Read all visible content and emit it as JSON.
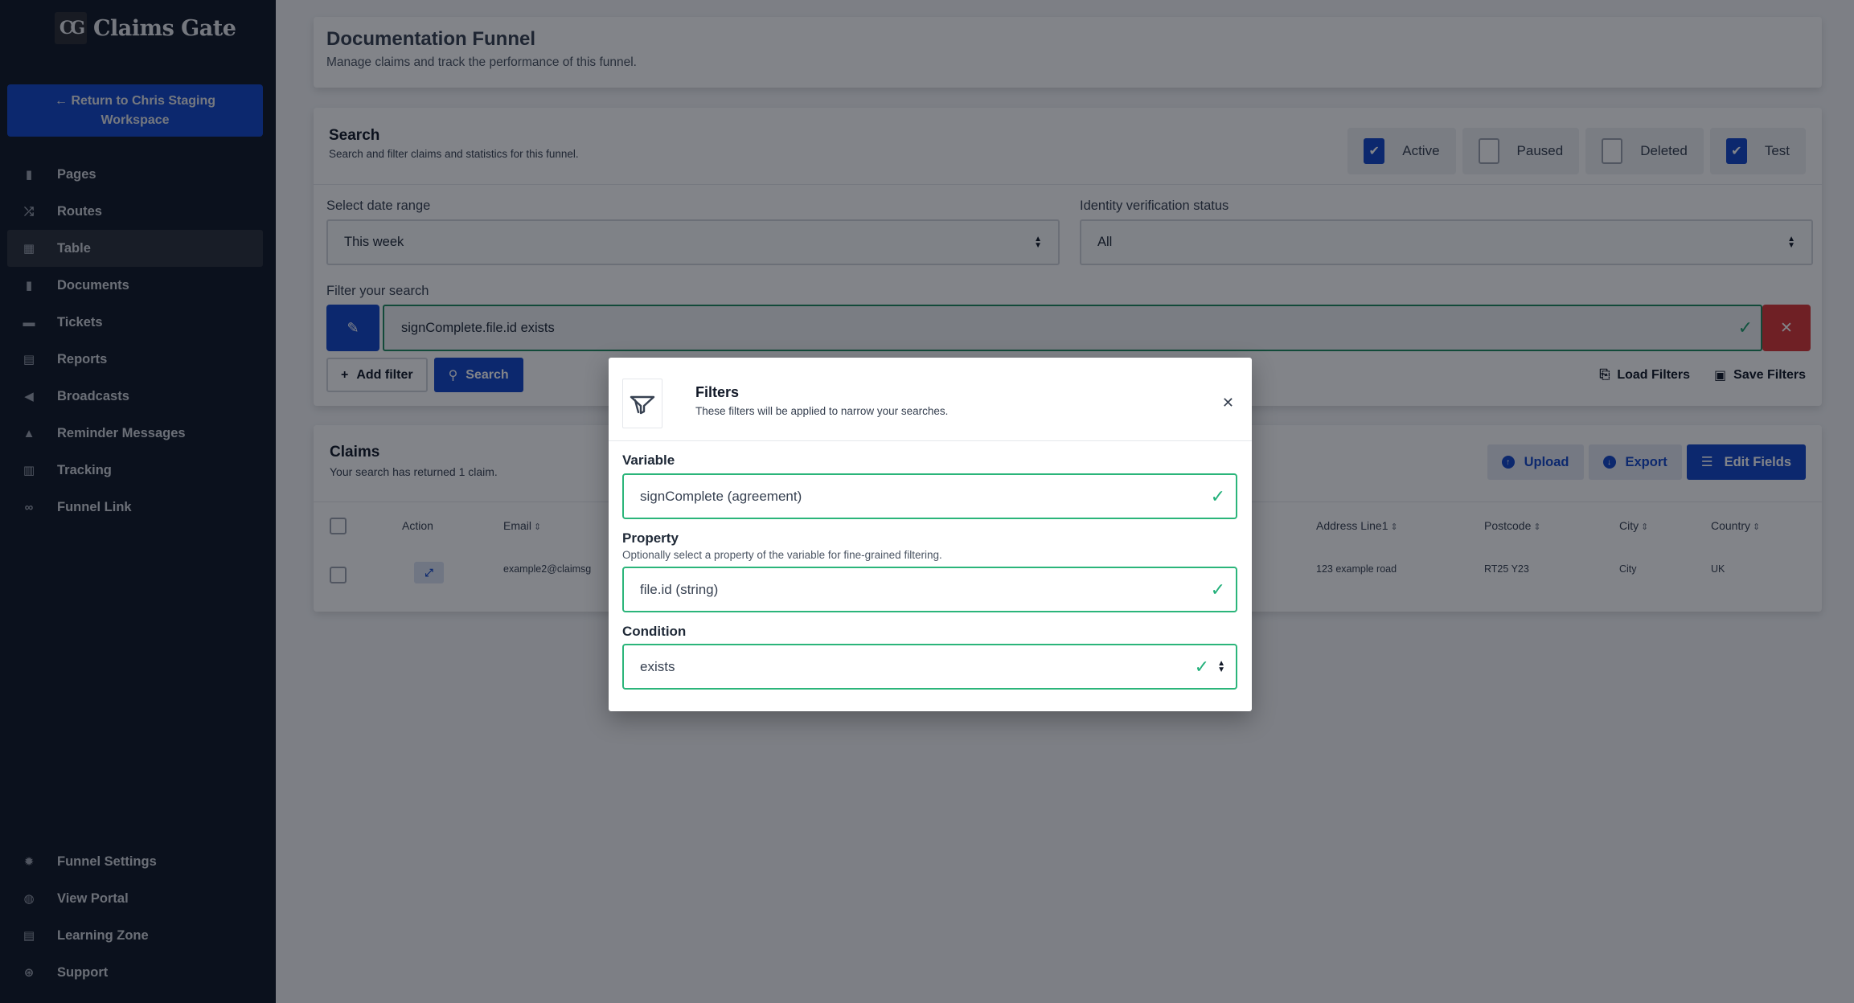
{
  "sidebar": {
    "brand_logo": "CG",
    "brand_name": "Claims Gate",
    "return_button": "← Return to Chris Staging Workspace",
    "nav_top": [
      {
        "label": "Pages",
        "icon": "file-icon",
        "glyph": "▮",
        "active": false
      },
      {
        "label": "Routes",
        "icon": "shuffle-icon",
        "glyph": "⤮",
        "active": false
      },
      {
        "label": "Table",
        "icon": "table-icon",
        "glyph": "▦",
        "active": true
      },
      {
        "label": "Documents",
        "icon": "file-icon",
        "glyph": "▮",
        "active": false
      },
      {
        "label": "Tickets",
        "icon": "ticket-icon",
        "glyph": "▬",
        "active": false
      },
      {
        "label": "Reports",
        "icon": "book-icon",
        "glyph": "▤",
        "active": false
      },
      {
        "label": "Broadcasts",
        "icon": "megaphone-icon",
        "glyph": "◀",
        "active": false
      },
      {
        "label": "Reminder Messages",
        "icon": "bell-icon",
        "glyph": "▲",
        "active": false
      },
      {
        "label": "Tracking",
        "icon": "receipt-icon",
        "glyph": "▥",
        "active": false
      },
      {
        "label": "Funnel Link",
        "icon": "link-icon",
        "glyph": "∞",
        "active": false
      }
    ],
    "nav_bottom": [
      {
        "label": "Funnel Settings",
        "icon": "gear-icon",
        "glyph": "✹"
      },
      {
        "label": "View Portal",
        "icon": "globe-icon",
        "glyph": "◍"
      },
      {
        "label": "Learning Zone",
        "icon": "book-icon",
        "glyph": "▤"
      },
      {
        "label": "Support",
        "icon": "lifebuoy-icon",
        "glyph": "⊛"
      }
    ]
  },
  "header": {
    "title": "Documentation Funnel",
    "subtitle": "Manage claims and track the performance of this funnel."
  },
  "search": {
    "title": "Search",
    "subtitle": "Search and filter claims and statistics for this funnel.",
    "statuses": [
      {
        "label": "Active",
        "checked": true
      },
      {
        "label": "Paused",
        "checked": false
      },
      {
        "label": "Deleted",
        "checked": false
      },
      {
        "label": "Test",
        "checked": true
      }
    ],
    "date_range_label": "Select date range",
    "date_range_value": "This week",
    "identity_label": "Identity verification status",
    "identity_value": "All",
    "filter_label": "Filter your search",
    "filter_value": "signComplete.file.id exists",
    "add_filter": "Add filter",
    "search_button": "Search",
    "load_filters": "Load Filters",
    "save_filters": "Save Filters"
  },
  "claims": {
    "title": "Claims",
    "subtitle": "Your search has returned 1 claim.",
    "upload": "Upload",
    "export": "Export",
    "edit_fields": "Edit Fields",
    "columns": {
      "action": "Action",
      "email": "Email",
      "address": "Address Line1",
      "postcode": "Postcode",
      "city": "City",
      "country": "Country"
    },
    "rows": [
      {
        "email": "example2@claimsg",
        "address": "123 example road",
        "postcode": "RT25 Y23",
        "city": "City",
        "country": "UK"
      }
    ]
  },
  "modal": {
    "title": "Filters",
    "subtitle": "These filters will be applied to narrow your searches.",
    "variable_label": "Variable",
    "variable_value": "signComplete (agreement)",
    "property_label": "Property",
    "property_help": "Optionally select a property of the variable for fine-grained filtering.",
    "property_value": "file.id (string)",
    "condition_label": "Condition",
    "condition_value": "exists"
  },
  "colors": {
    "primary": "#1246c8",
    "success": "#2bb57a",
    "danger": "#d93636",
    "sidebar_bg": "#111827"
  }
}
